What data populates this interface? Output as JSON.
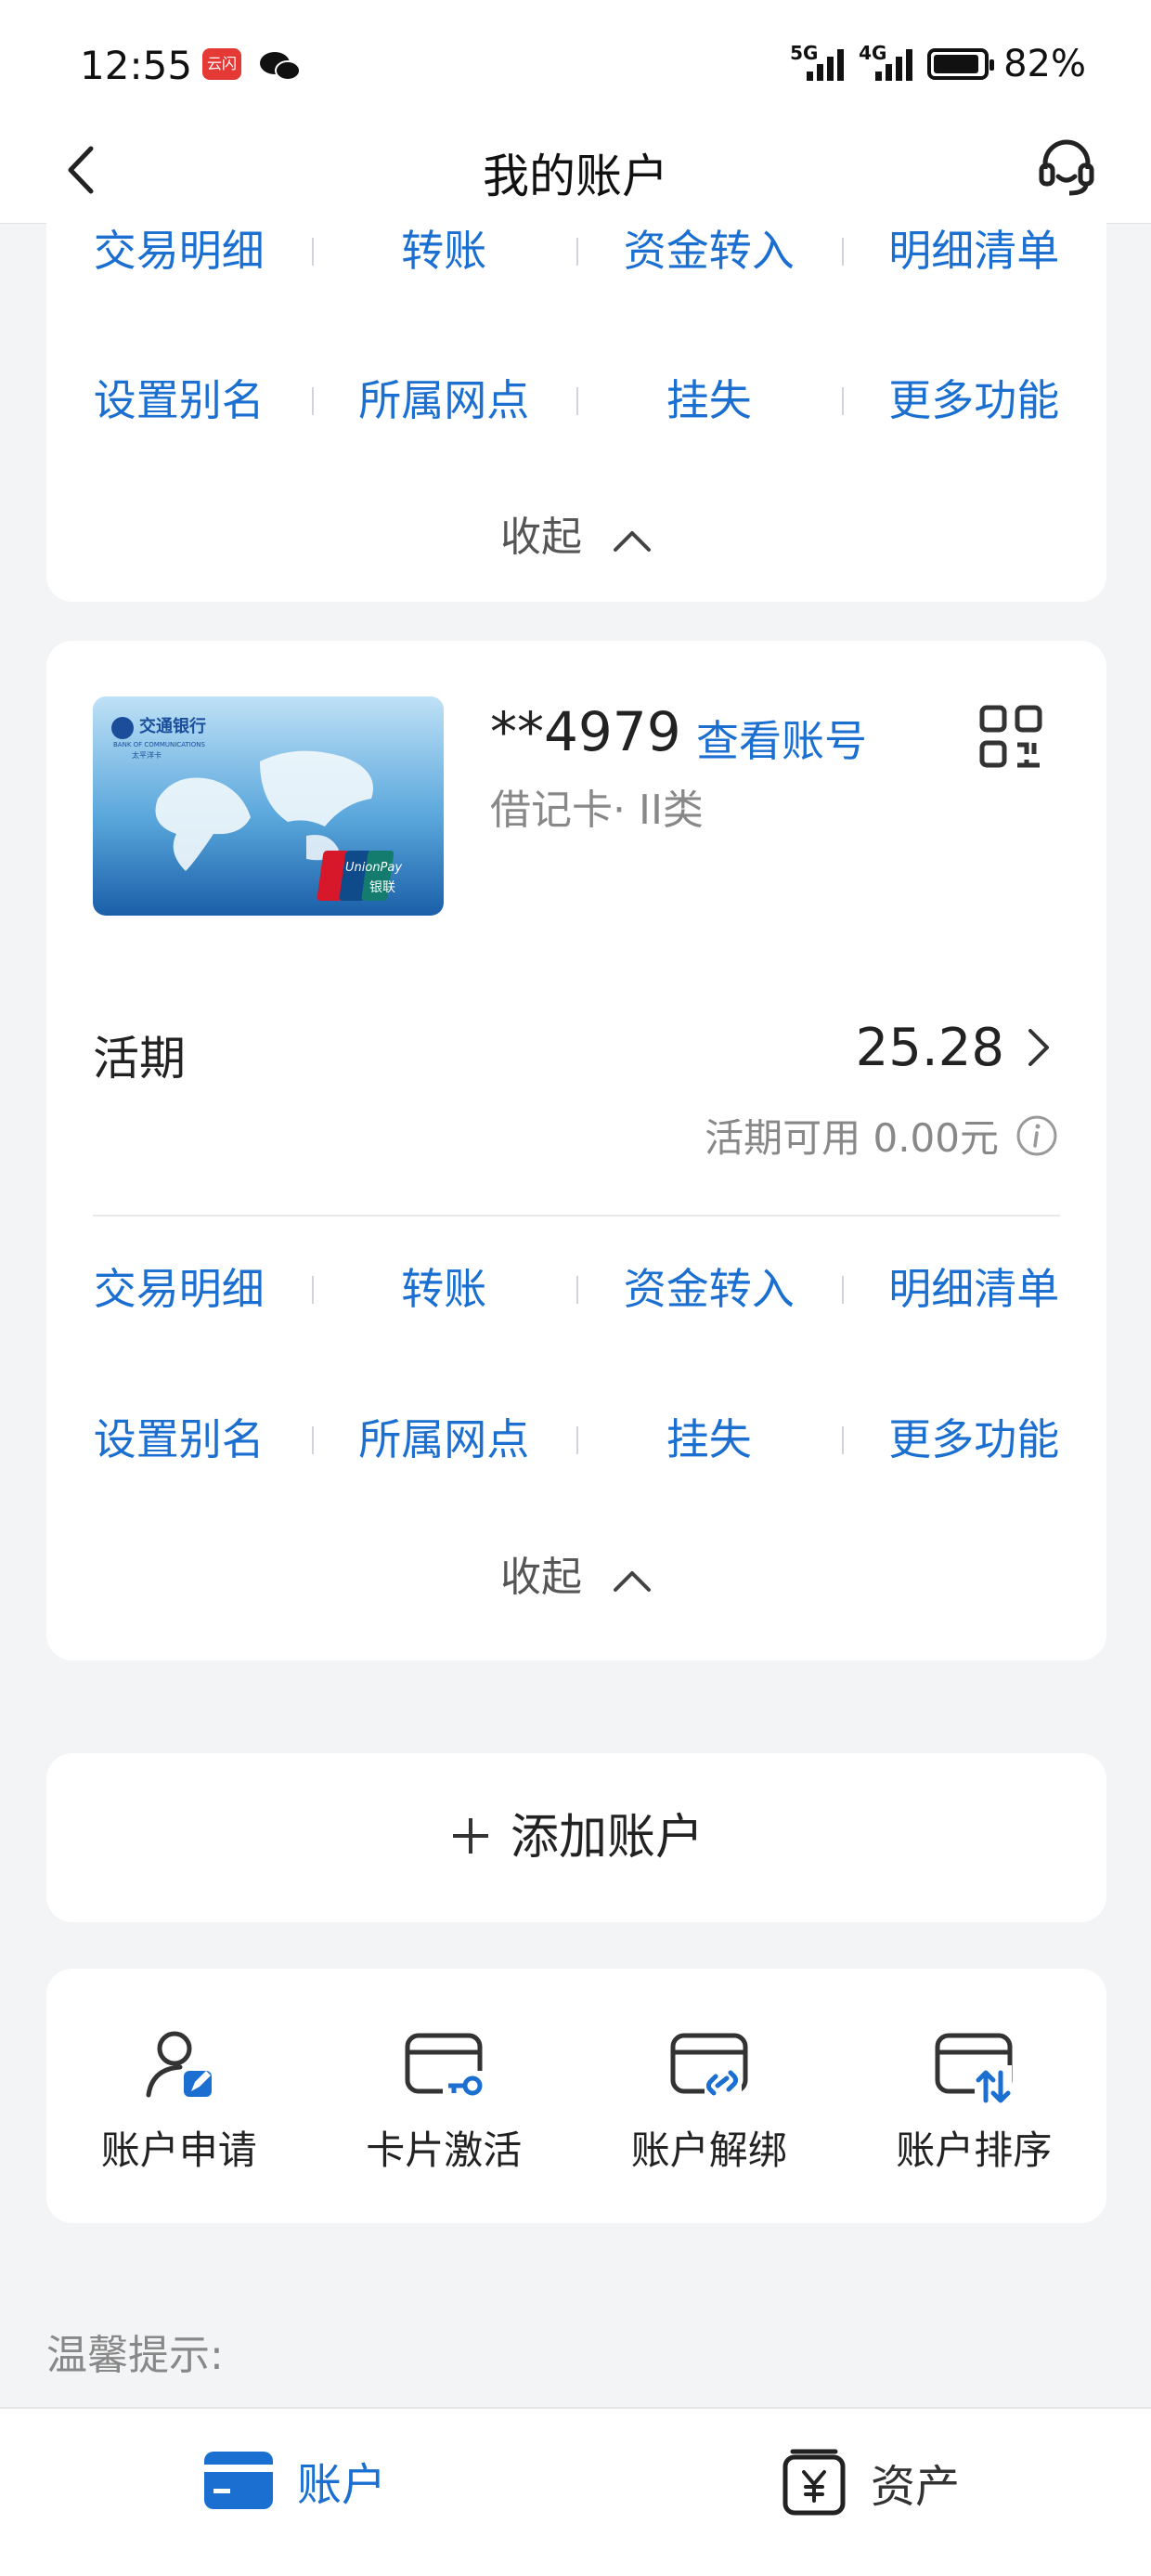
{
  "status_bar": {
    "time": "12:55",
    "app_badge": "云闪付",
    "network1": "5G",
    "network2": "4G",
    "battery": "82%",
    "battery_level": 0.82
  },
  "nav": {
    "title": "我的账户",
    "back_icon": "chevron-left-icon",
    "service_icon": "headset-icon"
  },
  "card_top_actions": {
    "row1": [
      "交易明细",
      "转账",
      "资金转入",
      "明细清单"
    ],
    "row2": [
      "设置别名",
      "所属网点",
      "挂失",
      "更多功能"
    ],
    "collapse_label": "收起"
  },
  "account": {
    "bank_name": "交通银行",
    "bank_name_en": "BANK OF COMMUNICATIONS",
    "card_subtitle": "太平洋卡",
    "card_logo": "UnionPay",
    "card_logo_cn": "银联",
    "masked_number": "**4979",
    "view_number_label": "查看账号",
    "card_type": "借记卡· II类",
    "deposit_label": "活期",
    "balance": "25.28",
    "available_label": "活期可用 0.00元",
    "actions_row1": [
      "交易明细",
      "转账",
      "资金转入",
      "明细清单"
    ],
    "actions_row2": [
      "设置别名",
      "所属网点",
      "挂失",
      "更多功能"
    ],
    "collapse_label": "收起"
  },
  "add_account": {
    "label": "添加账户"
  },
  "services": [
    {
      "label": "账户申请",
      "icon": "user-edit-icon"
    },
    {
      "label": "卡片激活",
      "icon": "card-key-icon"
    },
    {
      "label": "账户解绑",
      "icon": "card-unlink-icon"
    },
    {
      "label": "账户排序",
      "icon": "card-sort-icon"
    }
  ],
  "tips": {
    "label": "温馨提示:"
  },
  "tabbar": {
    "tabs": [
      {
        "label": "账户",
        "icon": "card-icon",
        "active": true
      },
      {
        "label": "资产",
        "icon": "yuan-box-icon",
        "active": false
      }
    ]
  },
  "colors": {
    "accent": "#1a6fd1",
    "muted": "#888888",
    "background": "#f3f4f6"
  }
}
